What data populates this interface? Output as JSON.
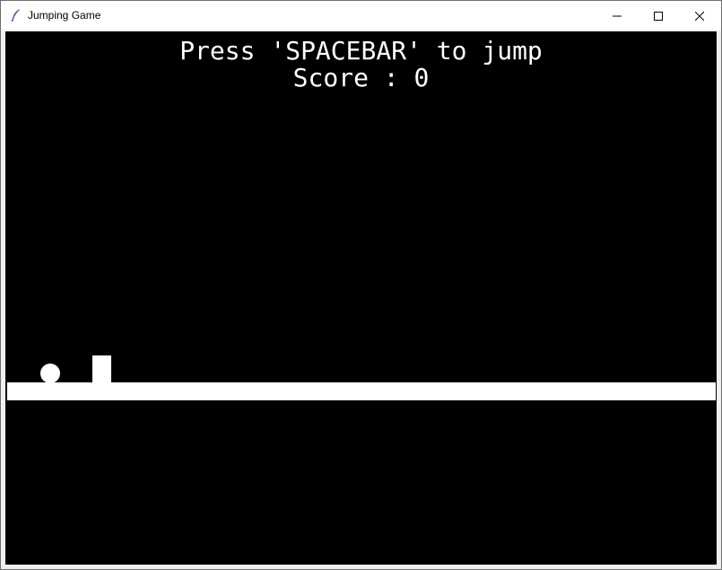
{
  "window": {
    "title": "Jumping Game",
    "icon": "feather-icon",
    "controls": [
      "minimize-icon",
      "maximize-icon",
      "close-icon"
    ]
  },
  "game": {
    "instruction": "Press 'SPACEBAR' to jump",
    "score_label": "Score",
    "score_separator": ":",
    "score_value": 0,
    "score_text": "Score : 0",
    "colors": {
      "background": "#000000",
      "foreground": "#ffffff"
    }
  }
}
